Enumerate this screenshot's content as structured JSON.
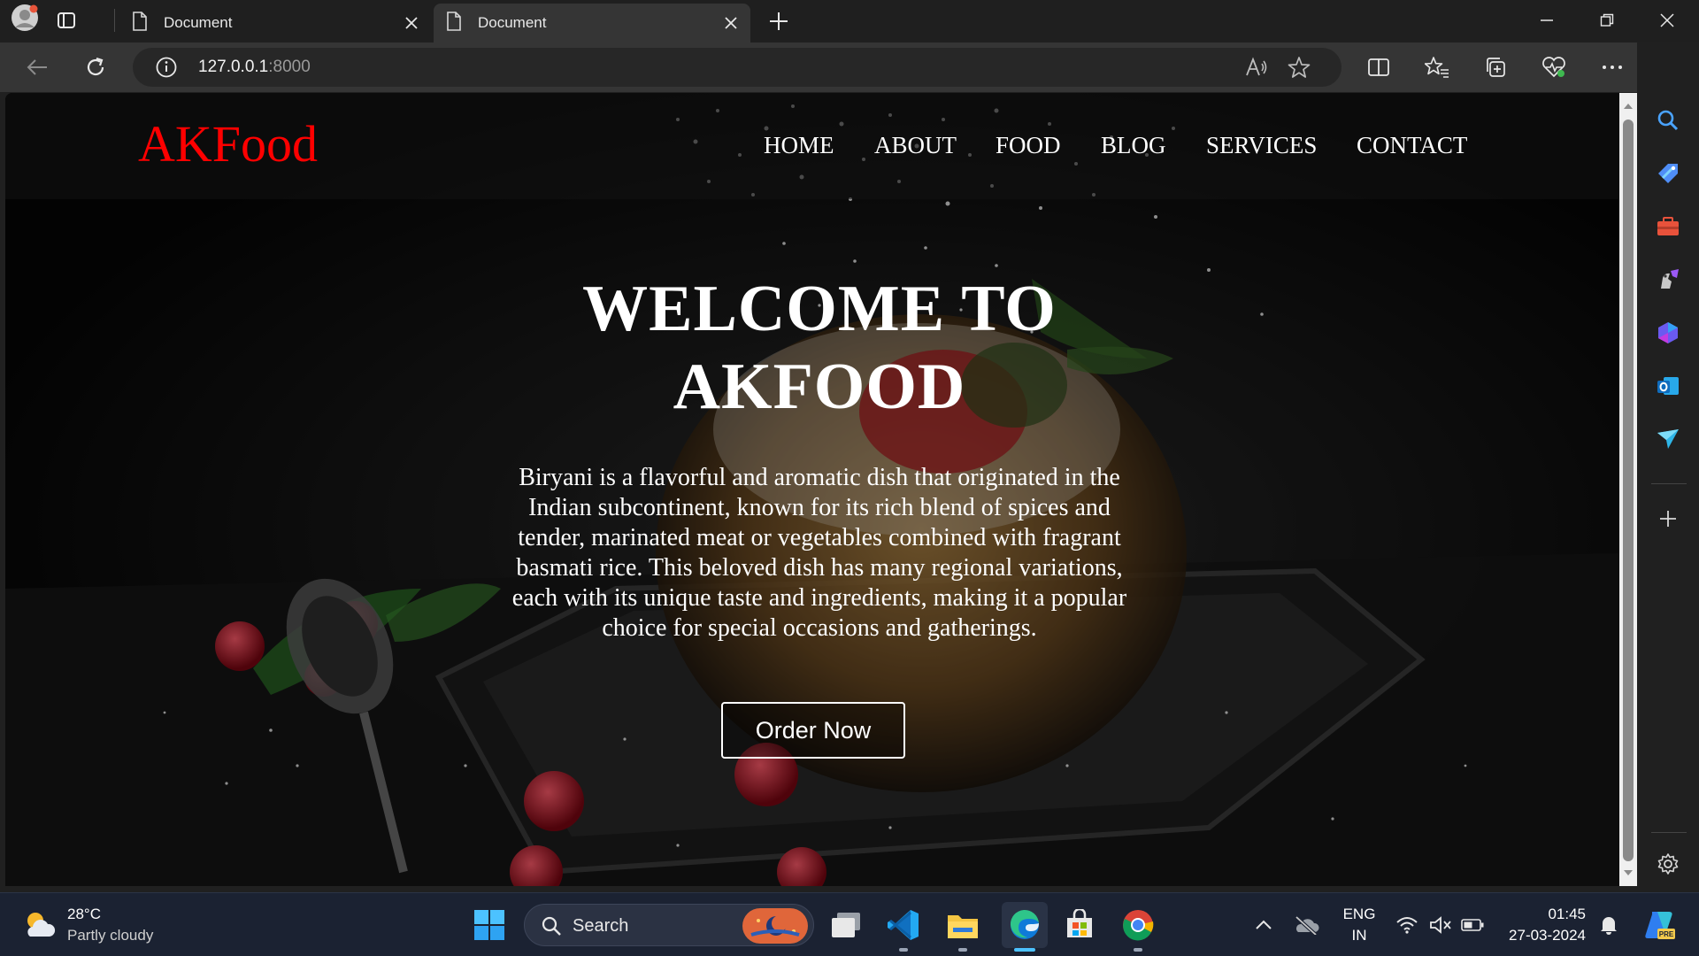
{
  "browser": {
    "tabs": [
      {
        "title": "Document",
        "active": false
      },
      {
        "title": "Document",
        "active": true
      }
    ],
    "address": {
      "host": "127.0.0.1",
      "port": ":8000"
    }
  },
  "site": {
    "logo": "AKFood",
    "nav": [
      "HOME",
      "ABOUT",
      "FOOD",
      "BLOG",
      "SERVICES",
      "CONTACT"
    ],
    "hero_title_line1": "WELCOME TO",
    "hero_title_line2": "AKFOOD",
    "hero_text": "Biryani is a flavorful and aromatic dish that originated in the Indian subcontinent, known for its rich blend of spices and tender, marinated meat or vegetables combined with fragrant basmati rice. This beloved dish has many regional variations, each with its unique taste and ingredients, making it a popular choice for special occasions and gatherings.",
    "cta": "Order Now",
    "colors": {
      "logo": "#ff0000",
      "text": "#ffffff"
    }
  },
  "taskbar": {
    "weather": {
      "temp": "28°C",
      "condition": "Partly cloudy"
    },
    "search_label": "Search",
    "lang_top": "ENG",
    "lang_bottom": "IN",
    "time": "01:45",
    "date": "27-03-2024"
  },
  "icons": {
    "titlebar": [
      "profile-avatar-icon",
      "tab-actions-icon",
      "document-icon",
      "close-icon",
      "new-tab-icon",
      "minimize-icon",
      "restore-icon",
      "window-close-icon"
    ],
    "toolbar": [
      "back-icon",
      "refresh-icon",
      "info-icon",
      "read-aloud-icon",
      "favorite-star-icon",
      "split-screen-icon",
      "favorites-icon",
      "collections-icon",
      "browser-essentials-icon",
      "more-icon",
      "copilot-icon"
    ],
    "sidebar": [
      "search-icon",
      "shopping-tag-icon",
      "tools-icon",
      "games-icon",
      "microsoft-365-icon",
      "outlook-icon",
      "drop-icon",
      "add-icon",
      "settings-icon"
    ],
    "taskbar": [
      "weather-icon",
      "start-icon",
      "search-icon",
      "task-view-icon",
      "vscode-icon",
      "file-explorer-icon",
      "edge-icon",
      "store-icon",
      "chrome-icon",
      "chevron-up-icon",
      "onedrive-icon",
      "wifi-icon",
      "volume-muted-icon",
      "battery-icon",
      "notification-bell-icon",
      "copilot-icon"
    ]
  }
}
